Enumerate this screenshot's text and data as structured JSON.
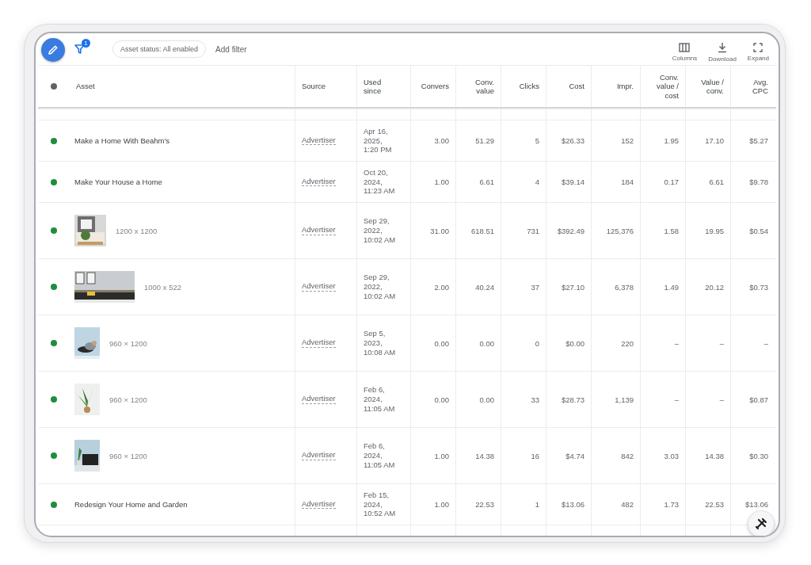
{
  "toolbar": {
    "filter_count": "1",
    "status_chip": "Asset status: All enabled",
    "add_filter": "Add filter",
    "actions": [
      {
        "kind": "columns",
        "label": "Columns"
      },
      {
        "kind": "download",
        "label": "Download"
      },
      {
        "kind": "expand",
        "label": "Expand"
      }
    ]
  },
  "table": {
    "columns": [
      "Asset",
      "Source",
      "Used since",
      "Convers",
      "Conv. value",
      "Clicks",
      "Cost",
      "Impr.",
      "Conv. value / cost",
      "Value / conv.",
      "Avg. CPC"
    ],
    "rows": [
      {
        "enabled": true,
        "kind": "text",
        "asset": "Make a Home With Beahm's",
        "source": "Advertiser",
        "used_since": "Apr 16, 2025, 1:20 PM",
        "values": [
          "3.00",
          "51.29",
          "5",
          "$26.33",
          "152",
          "1.95",
          "17.10",
          "$5.27"
        ]
      },
      {
        "enabled": true,
        "kind": "text",
        "asset": "Make Your House a Home",
        "source": "Advertiser",
        "used_since": "Oct 20, 2024, 11:23 AM",
        "values": [
          "1.00",
          "6.61",
          "4",
          "$39.14",
          "184",
          "0.17",
          "6.61",
          "$9.78"
        ]
      },
      {
        "enabled": true,
        "asset": "1200 x 1200",
        "source": "Advertiser",
        "used_since": "Sep 29, 2022, 10:02 AM",
        "values": [
          "31.00",
          "618.51",
          "731",
          "$392.49",
          "125,376",
          "1.58",
          "19.95",
          "$0.54"
        ]
      },
      {
        "enabled": true,
        "asset": "1000 x 522",
        "source": "Advertiser",
        "used_since": "Sep 29, 2022, 10:02 AM",
        "values": [
          "2.00",
          "40.24",
          "37",
          "$27.10",
          "6,378",
          "1.49",
          "20.12",
          "$0.73"
        ]
      },
      {
        "enabled": true,
        "asset": "960 × 1200",
        "source": "Advertiser",
        "used_since": "Sep 5, 2023, 10:08 AM",
        "values": [
          "0.00",
          "0.00",
          "0",
          "$0.00",
          "220",
          "–",
          "–",
          "–"
        ]
      },
      {
        "enabled": true,
        "asset": "960 × 1200",
        "source": "Advertiser",
        "used_since": "Feb 6, 2024, 11:05 AM",
        "values": [
          "0.00",
          "0.00",
          "33",
          "$28.73",
          "1,139",
          "–",
          "–",
          "$0.87"
        ]
      },
      {
        "enabled": true,
        "asset": "960 × 1200",
        "source": "Advertiser",
        "used_since": "Feb 6, 2024, 11:05 AM",
        "values": [
          "1.00",
          "14.38",
          "16",
          "$4.74",
          "842",
          "3.03",
          "14.38",
          "$0.30"
        ]
      },
      {
        "enabled": true,
        "kind": "text",
        "asset": "Redesign Your Home and Garden",
        "source": "Advertiser",
        "used_since": "Feb 15, 2024, 10:52 AM",
        "values": [
          "1.00",
          "22.53",
          "1",
          "$13.06",
          "482",
          "1.73",
          "22.53",
          "$13.06"
        ]
      }
    ]
  }
}
